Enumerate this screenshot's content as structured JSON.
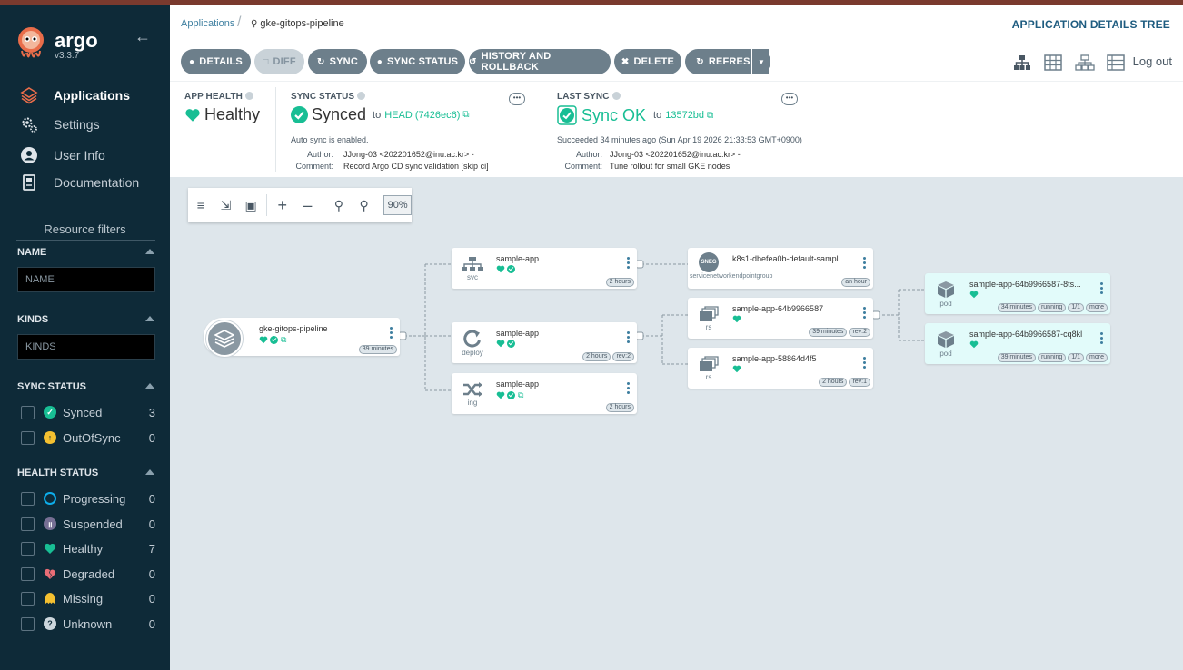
{
  "colors": {
    "sidebar_bg": "#0e2a38",
    "accent": "#18be94",
    "link": "#3e7fa0",
    "button": "#6d7f8b",
    "pod_bg": "#e2fbfa",
    "healthy": "#18be94",
    "degraded": "#e96d76",
    "missing": "#f4c030",
    "progressing": "#0dadea",
    "suspended": "#766f94"
  },
  "sidebar": {
    "logo_text": "argo",
    "version": "v3.3.7",
    "nav": [
      {
        "label": "Applications",
        "icon": "layers-icon"
      },
      {
        "label": "Settings",
        "icon": "gears-icon"
      },
      {
        "label": "User Info",
        "icon": "user-icon"
      },
      {
        "label": "Documentation",
        "icon": "book-icon"
      }
    ],
    "resource_filters_title": "Resource filters",
    "name_section": {
      "title": "NAME",
      "placeholder": "NAME"
    },
    "kinds_section": {
      "title": "KINDS",
      "placeholder": "KINDS"
    },
    "sync_status": {
      "title": "SYNC STATUS",
      "items": [
        {
          "label": "Synced",
          "count": "3",
          "icon": "synced-icon"
        },
        {
          "label": "OutOfSync",
          "count": "0",
          "icon": "out-of-sync-icon"
        }
      ]
    },
    "health_status": {
      "title": "HEALTH STATUS",
      "items": [
        {
          "label": "Progressing",
          "count": "0",
          "icon": "progressing-icon"
        },
        {
          "label": "Suspended",
          "count": "0",
          "icon": "suspended-icon"
        },
        {
          "label": "Healthy",
          "count": "7",
          "icon": "heart-icon"
        },
        {
          "label": "Degraded",
          "count": "0",
          "icon": "broken-heart-icon"
        },
        {
          "label": "Missing",
          "count": "0",
          "icon": "ghost-icon"
        },
        {
          "label": "Unknown",
          "count": "0",
          "icon": "question-icon"
        }
      ]
    }
  },
  "header": {
    "breadcrumb_root": "Applications",
    "breadcrumb_current": "gke-gitops-pipeline",
    "page_title": "APPLICATION DETAILS TREE"
  },
  "toolbar": {
    "buttons": [
      {
        "label": "DETAILS",
        "icon": "info-icon"
      },
      {
        "label": "DIFF",
        "icon": "file-icon",
        "disabled": true
      },
      {
        "label": "SYNC",
        "icon": "sync-icon"
      },
      {
        "label": "SYNC STATUS",
        "icon": "info-icon"
      },
      {
        "label": "HISTORY AND ROLLBACK",
        "icon": "history-icon"
      },
      {
        "label": "DELETE",
        "icon": "delete-icon"
      },
      {
        "label": "REFRESH",
        "icon": "refresh-icon"
      }
    ],
    "logout": "Log out"
  },
  "app_health": {
    "label": "APP HEALTH",
    "value": "Healthy"
  },
  "sync_status": {
    "label": "SYNC STATUS",
    "value": "Synced",
    "to": "to",
    "revision": "HEAD (7426ec6)",
    "auto_sync": "Auto sync is enabled.",
    "author_key": "Author:",
    "author": "JJong-03 <202201652@inu.ac.kr> -",
    "comment_key": "Comment:",
    "comment": "Record Argo CD sync validation [skip ci]"
  },
  "last_sync": {
    "label": "LAST SYNC",
    "value": "Sync OK",
    "to": "to",
    "revision": "13572bd",
    "succeeded": "Succeeded 34 minutes ago (Sun Apr 19 2026 21:33:53 GMT+0900)",
    "author_key": "Author:",
    "author": "JJong-03 <202201652@inu.ac.kr> -",
    "comment_key": "Comment:",
    "comment": "Tune rollout for small GKE nodes"
  },
  "graph": {
    "zoom": "90%",
    "nodes": [
      {
        "id": "app",
        "name": "gke-gitops-pipeline",
        "kind": "",
        "tags": [
          "39 minutes"
        ]
      },
      {
        "id": "svc",
        "name": "sample-app",
        "kind": "svc",
        "tags": [
          "2 hours"
        ]
      },
      {
        "id": "deploy",
        "name": "sample-app",
        "kind": "deploy",
        "tags": [
          "2 hours",
          "rev:2"
        ]
      },
      {
        "id": "ing",
        "name": "sample-app",
        "kind": "ing",
        "tags": [
          "2 hours"
        ]
      },
      {
        "id": "sneg",
        "name": "k8s1-dbefea0b-default-sampl...",
        "kind": "servicenetworkendpointgroup",
        "badge": "SNEG",
        "tags": [
          "an hour"
        ]
      },
      {
        "id": "rs1",
        "name": "sample-app-64b9966587",
        "kind": "rs",
        "tags": [
          "39 minutes",
          "rev:2"
        ]
      },
      {
        "id": "rs2",
        "name": "sample-app-58864d4f5",
        "kind": "rs",
        "tags": [
          "2 hours",
          "rev:1"
        ]
      },
      {
        "id": "pod1",
        "name": "sample-app-64b9966587-8ts...",
        "kind": "pod",
        "tags": [
          "34 minutes",
          "running",
          "1/1",
          "more"
        ]
      },
      {
        "id": "pod2",
        "name": "sample-app-64b9966587-cq8kl",
        "kind": "pod",
        "tags": [
          "39 minutes",
          "running",
          "1/1",
          "more"
        ]
      }
    ]
  }
}
